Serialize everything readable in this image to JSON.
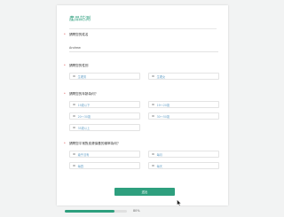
{
  "form": {
    "title": "產品訪測",
    "q1": {
      "label": "請問您的姓名",
      "value": "Andrew"
    },
    "q2": {
      "label": "請問您的性別",
      "options": [
        "生理男",
        "生理女"
      ]
    },
    "q3": {
      "label": "請問您的年齡為何？",
      "options": [
        "19歲以下",
        "19～20歲",
        "20～30歲",
        "30～50歲",
        "35歲以上"
      ]
    },
    "q4": {
      "label": "請問您平常對皮膚保養的頻率為何？",
      "options": [
        "幾乎沒有",
        "每月",
        "每週",
        "每天"
      ]
    },
    "submit_label": "送出"
  },
  "progress": {
    "percent": 80,
    "label": "80%"
  },
  "colors": {
    "accent": "#2e9f7e",
    "required": "#e05a5a"
  }
}
